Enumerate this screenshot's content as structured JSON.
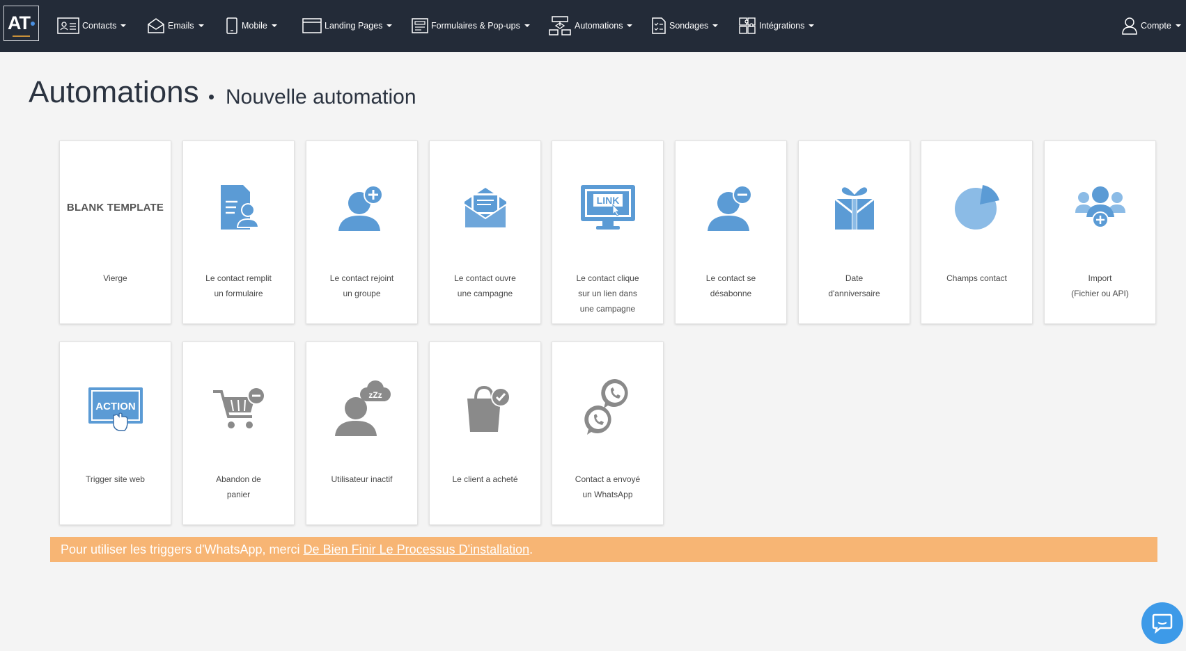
{
  "logo": {
    "text": "AT"
  },
  "nav": {
    "contacts": "Contacts",
    "emails": "Emails",
    "mobile": "Mobile",
    "landing": "Landing Pages",
    "forms": "Formulaires & Pop-ups",
    "automations": "Automations",
    "surveys": "Sondages",
    "integrations": "Intégrations",
    "account": "Compte"
  },
  "page": {
    "title": "Automations",
    "subtitle": "Nouvelle automation"
  },
  "cards": [
    {
      "label": "Vierge",
      "icon": "blank-template-text",
      "badge": "BLANK TEMPLATE"
    },
    {
      "label": "Le contact remplit\nun formulaire",
      "icon": "form-contact-icon"
    },
    {
      "label": "Le contact rejoint\nun groupe",
      "icon": "user-add-icon"
    },
    {
      "label": "Le contact ouvre\nune campagne",
      "icon": "open-envelope-icon"
    },
    {
      "label": "Le contact clique\nsur un lien dans\nune campagne",
      "icon": "link-monitor-icon",
      "badge": "LINK"
    },
    {
      "label": "Le contact se\ndésabonne",
      "icon": "user-remove-icon"
    },
    {
      "label": "Date\nd'anniversaire",
      "icon": "gift-icon"
    },
    {
      "label": "Champs contact",
      "icon": "pie-chart-icon"
    },
    {
      "label": "Import\n(Fichier ou API)",
      "icon": "users-import-icon"
    },
    {
      "label": "Trigger site web",
      "icon": "action-click-icon",
      "badge": "ACTION"
    },
    {
      "label": "Abandon de\npanier",
      "icon": "cart-remove-icon"
    },
    {
      "label": "Utilisateur inactif",
      "icon": "user-sleep-icon"
    },
    {
      "label": "Le client a acheté",
      "icon": "bag-check-icon"
    },
    {
      "label": "Contact a envoyé\nun WhatsApp",
      "icon": "whatsapp-icon"
    }
  ],
  "warning": {
    "text": "Pour utiliser les triggers d'WhatsApp, merci",
    "link": "De Bien Finir Le Processus D'installation",
    "end": "."
  },
  "colors": {
    "nav_bg": "#232b38",
    "icon_blue": "#5b9bd5",
    "icon_grey": "#8a8a8a",
    "warning_bg": "#f7b574",
    "chat_bg": "#3d9ae8"
  }
}
